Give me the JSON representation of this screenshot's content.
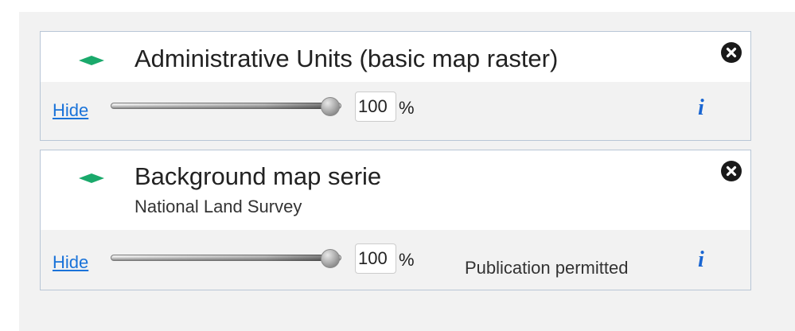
{
  "layers": [
    {
      "title": "Administrative Units (basic map raster)",
      "subtitle": "",
      "hide_label": "Hide",
      "opacity": "100",
      "opacity_unit": "%",
      "opacity_fraction": 1.0,
      "publication_status": "",
      "info_label": "i",
      "icons": {
        "layer_type": "layer-diamond-icon",
        "close": "close-icon",
        "info": "info-icon"
      }
    },
    {
      "title": "Background map serie",
      "subtitle": "National Land Survey",
      "hide_label": "Hide",
      "opacity": "100",
      "opacity_unit": "%",
      "opacity_fraction": 1.0,
      "publication_status": "Publication permitted",
      "info_label": "i",
      "icons": {
        "layer_type": "layer-diamond-icon",
        "close": "close-icon",
        "info": "info-icon"
      }
    }
  ],
  "colors": {
    "accent_green": "#1aa96b",
    "link_blue": "#1a73d9",
    "info_blue": "#1a66d2",
    "panel_bg": "#f2f2f2",
    "card_border": "#b8c6d6"
  }
}
